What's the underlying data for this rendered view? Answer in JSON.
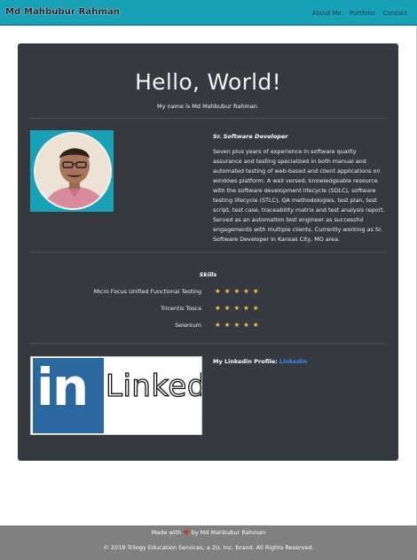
{
  "navbar": {
    "brand": "Md Mahbubur Rahman",
    "links": [
      "About Me",
      "Portfolio",
      "Contact"
    ],
    "bg_color": "#17a2b8"
  },
  "hero": {
    "title": "Hello, World!",
    "subtitle": "My name is Md Mahbubur Rahman."
  },
  "about": {
    "role": "Sr. Software Developer",
    "bio": "Seven plus years of experience in software quality assurance and testing specialized in both manual and automated testing of web-based and client applications on windows platform. A well versed, knowledgeable resource with the software development lifecycle (SDLC), software testing lifecycle (STLC), QA methodologies, test plan, test script, test case, traceability matrix and test analysis report. Served as an automation test engineer as successful engagements with multiple clients. Currently working as Sr. Software Developer in Kansas City, MO area."
  },
  "skills": {
    "heading": "Skills",
    "items": [
      {
        "name": "Micro Focus Unified Functional Testing",
        "rating": 5,
        "stars": "★★★★★"
      },
      {
        "name": "Tricentis Tosca",
        "rating": 5,
        "stars": "★★★★★"
      },
      {
        "name": "Selenium",
        "rating": 5,
        "stars": "★★★★★"
      }
    ],
    "star_color": "#f6c343"
  },
  "linkedin": {
    "label": "My Linkedin Profile:",
    "link_text": "Linkedin",
    "logo_in": "in",
    "logo_linked": "Linked"
  },
  "footer": {
    "made_with_prefix": "Made with",
    "made_with_suffix": "by Md Mahbubur Rahman",
    "heart_icon": "heart-icon",
    "copyright": "© 2019 Trilogy Education Services, a 2U, Inc. brand. All Rights Reserved."
  }
}
